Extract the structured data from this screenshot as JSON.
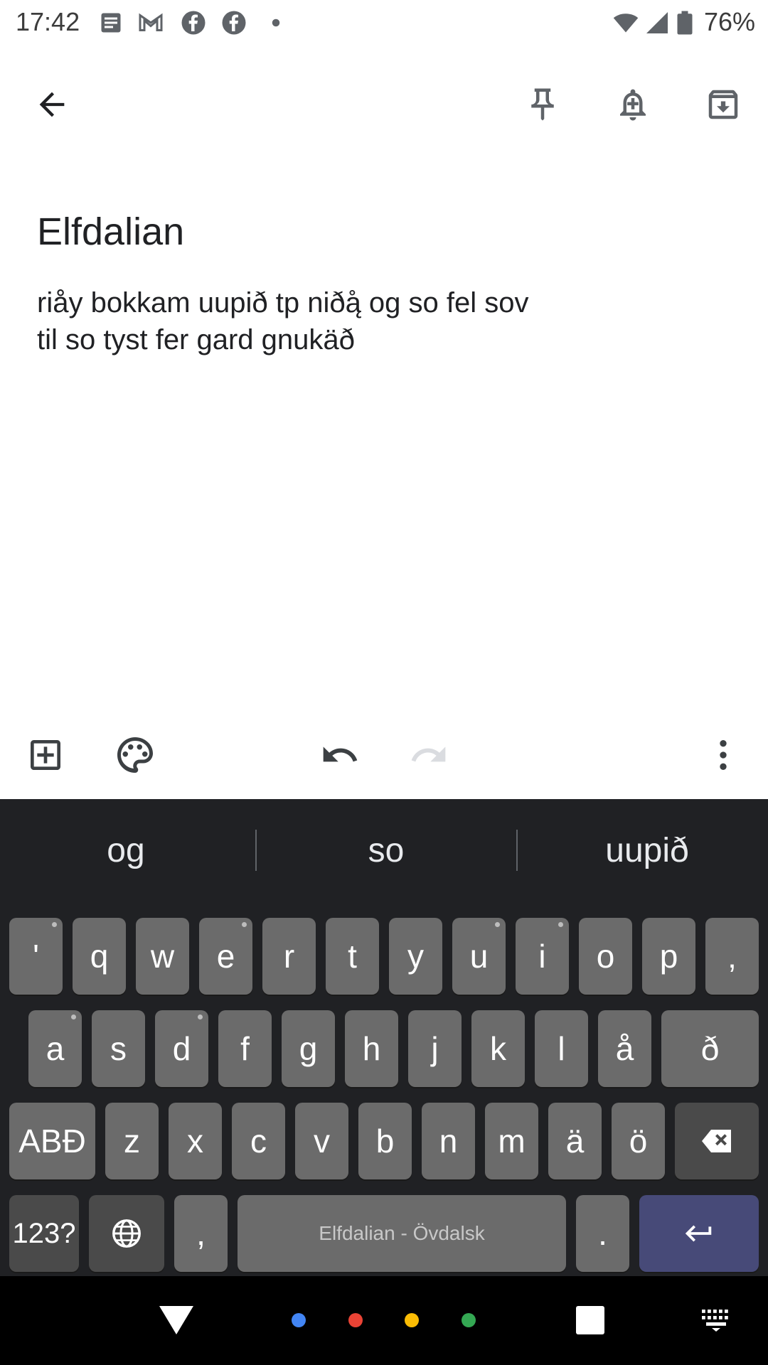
{
  "status_bar": {
    "time": "17:42",
    "battery": "76%",
    "icons": [
      "notes-icon",
      "gmail-icon",
      "facebook-icon",
      "facebook-icon",
      "dot-icon",
      "wifi-icon",
      "signal-icon",
      "battery-icon"
    ]
  },
  "app_bar": {
    "icons": [
      "back-arrow-icon",
      "pin-icon",
      "add-reminder-icon",
      "archive-icon"
    ]
  },
  "note": {
    "title": "Elfdalian",
    "body": "riåy bokkam uupið tp niðą̊ og so fel sov\ntil so tyst fer gard gnukäð"
  },
  "editor_toolbar": {
    "icons": [
      "add-box-icon",
      "palette-icon",
      "undo-icon",
      "redo-icon",
      "more-vert-icon"
    ]
  },
  "keyboard": {
    "suggestions": [
      "og",
      "so",
      "uupið"
    ],
    "row1": [
      "'",
      "q",
      "w",
      "e",
      "r",
      "t",
      "y",
      "u",
      "i",
      "o",
      "p",
      "‚"
    ],
    "row2": [
      "a",
      "s",
      "d",
      "f",
      "g",
      "h",
      "j",
      "k",
      "l",
      "å",
      "ð"
    ],
    "row3": [
      "ABÐ",
      "z",
      "x",
      "c",
      "v",
      "b",
      "n",
      "m",
      "ä",
      "ö"
    ],
    "row4": {
      "numbers": "123?",
      "comma": ",",
      "space": "Elfdalian - Övdalsk",
      "period": "."
    }
  },
  "nav_bar": {
    "icons": [
      "back-triangle-icon",
      "assistant-dots-icon",
      "recents-square-icon",
      "keyboard-switch-icon"
    ],
    "dot_colors": [
      "#4285f4",
      "#ea4335",
      "#fbbc04",
      "#34a853"
    ]
  }
}
